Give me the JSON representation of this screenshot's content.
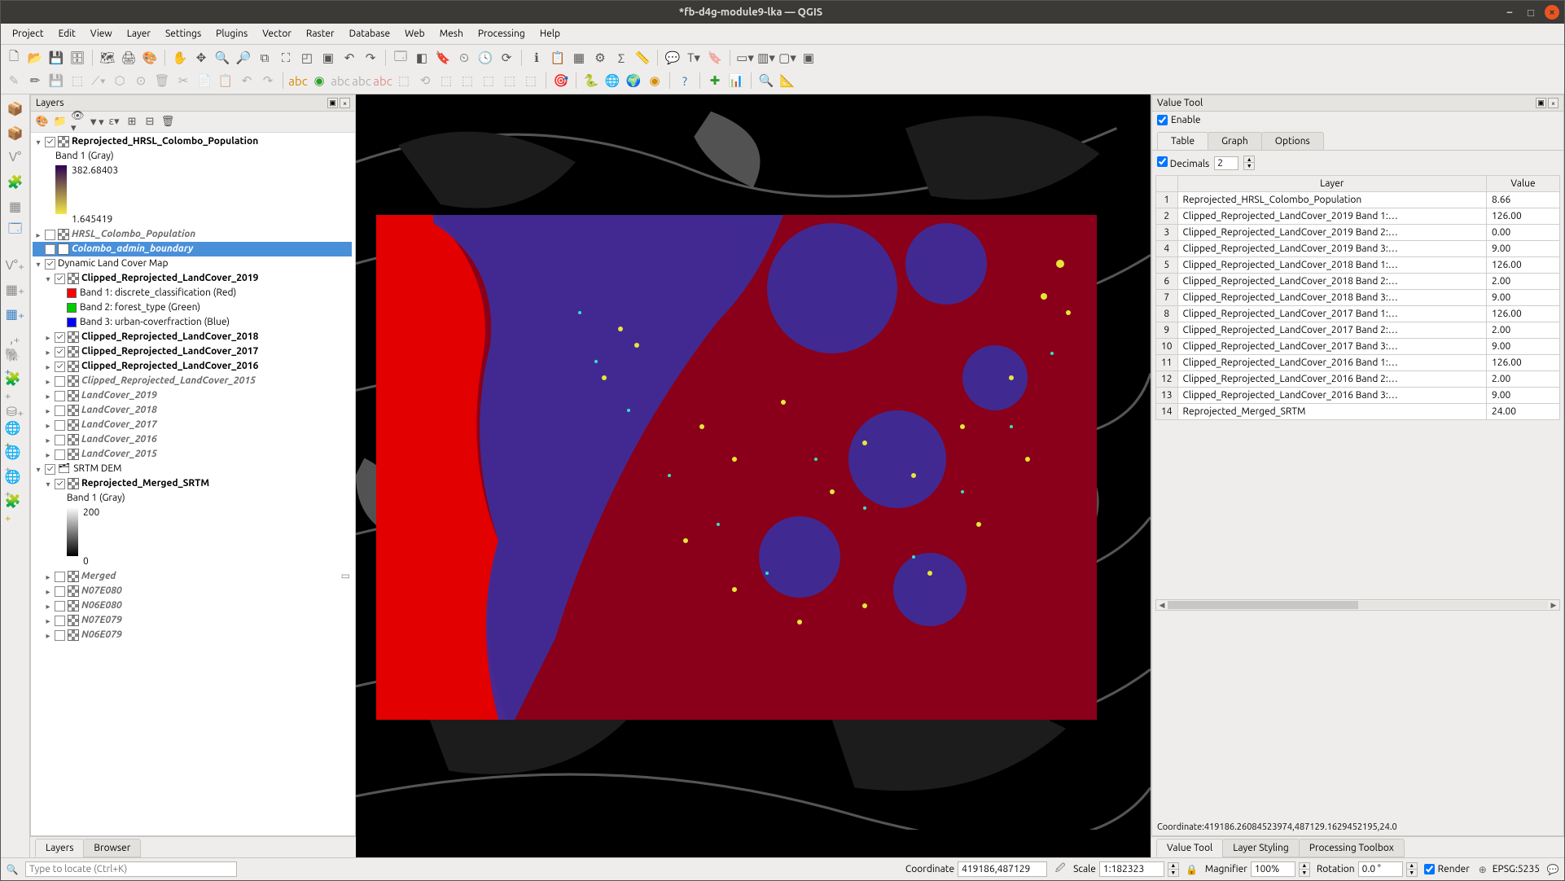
{
  "window": {
    "title": "*fb-d4g-module9-lka — QGIS"
  },
  "menu": [
    "Project",
    "Edit",
    "View",
    "Layer",
    "Settings",
    "Plugins",
    "Vector",
    "Raster",
    "Database",
    "Web",
    "Mesh",
    "Processing",
    "Help"
  ],
  "panels": {
    "layers": {
      "title": "Layers"
    },
    "value_tool": {
      "title": "Value Tool",
      "enable": "Enable",
      "tabs": [
        "Table",
        "Graph",
        "Options"
      ],
      "decimals_label": "Decimals",
      "decimals_value": "2",
      "headers": {
        "layer": "Layer",
        "value": "Value"
      },
      "rows": [
        {
          "n": "1",
          "layer": "Reprojected_HRSL_Colombo_Population",
          "value": "8.66"
        },
        {
          "n": "2",
          "layer": "Clipped_Reprojected_LandCover_2019 Band 1:…",
          "value": "126.00"
        },
        {
          "n": "3",
          "layer": "Clipped_Reprojected_LandCover_2019 Band 2:…",
          "value": "0.00"
        },
        {
          "n": "4",
          "layer": "Clipped_Reprojected_LandCover_2019 Band 3:…",
          "value": "9.00"
        },
        {
          "n": "5",
          "layer": "Clipped_Reprojected_LandCover_2018 Band 1:…",
          "value": "126.00"
        },
        {
          "n": "6",
          "layer": "Clipped_Reprojected_LandCover_2018 Band 2:…",
          "value": "2.00"
        },
        {
          "n": "7",
          "layer": "Clipped_Reprojected_LandCover_2018 Band 3:…",
          "value": "9.00"
        },
        {
          "n": "8",
          "layer": "Clipped_Reprojected_LandCover_2017 Band 1:…",
          "value": "126.00"
        },
        {
          "n": "9",
          "layer": "Clipped_Reprojected_LandCover_2017 Band 2:…",
          "value": "2.00"
        },
        {
          "n": "10",
          "layer": "Clipped_Reprojected_LandCover_2017 Band 3:…",
          "value": "9.00"
        },
        {
          "n": "11",
          "layer": "Clipped_Reprojected_LandCover_2016 Band 1:…",
          "value": "126.00"
        },
        {
          "n": "12",
          "layer": "Clipped_Reprojected_LandCover_2016 Band 2:…",
          "value": "2.00"
        },
        {
          "n": "13",
          "layer": "Clipped_Reprojected_LandCover_2016 Band 3:…",
          "value": "9.00"
        },
        {
          "n": "14",
          "layer": "Reprojected_Merged_SRTM",
          "value": "24.00"
        }
      ],
      "coord_line": "Coordinate:419186.26084523974,487129.1629452195,24.0"
    }
  },
  "layers_bottom_tabs": [
    "Layers",
    "Browser"
  ],
  "right_bottom_tabs": [
    "Value Tool",
    "Layer Styling",
    "Processing Toolbox"
  ],
  "layers_tree": {
    "hrsl": {
      "name": "Reprojected_HRSL_Colombo_Population",
      "band": "Band 1 (Gray)",
      "max": "382.68403",
      "min": "1.645419"
    },
    "hrsl_inact": "HRSL_Colombo_Population",
    "colombo_boundary": "Colombo_admin_boundary",
    "dlc_group": "Dynamic Land Cover Map",
    "dlc2019": {
      "name": "Clipped_Reprojected_LandCover_2019",
      "b1": "Band 1: discrete_classification (Red)",
      "b2": "Band 2: forest_type (Green)",
      "b3": "Band 3: urban-coverfraction (Blue)"
    },
    "dlc2018": "Clipped_Reprojected_LandCover_2018",
    "dlc2017": "Clipped_Reprojected_LandCover_2017",
    "dlc2016": "Clipped_Reprojected_LandCover_2016",
    "dlc2015_inact": "Clipped_Reprojected_LandCover_2015",
    "lc2019": "LandCover_2019",
    "lc2018": "LandCover_2018",
    "lc2017": "LandCover_2017",
    "lc2016": "LandCover_2016",
    "lc2015": "LandCover_2015",
    "srtm_group": "SRTM DEM",
    "srtm_reproj": {
      "name": "Reprojected_Merged_SRTM",
      "band": "Band 1 (Gray)",
      "max": "200",
      "min": "0"
    },
    "merged": "Merged",
    "n07e080": "N07E080",
    "n06e080": "N06E080",
    "n07e079": "N07E079",
    "n06e079": "N06E079"
  },
  "status": {
    "locator_placeholder": "Type to locate (Ctrl+K)",
    "coord_label": "Coordinate",
    "coord_value": "419186,487129",
    "scale_label": "Scale",
    "scale_value": "1:182323",
    "magnifier_label": "Magnifier",
    "magnifier_value": "100%",
    "rotation_label": "Rotation",
    "rotation_value": "0.0 °",
    "render_label": "Render",
    "crs": "EPSG:5235"
  }
}
